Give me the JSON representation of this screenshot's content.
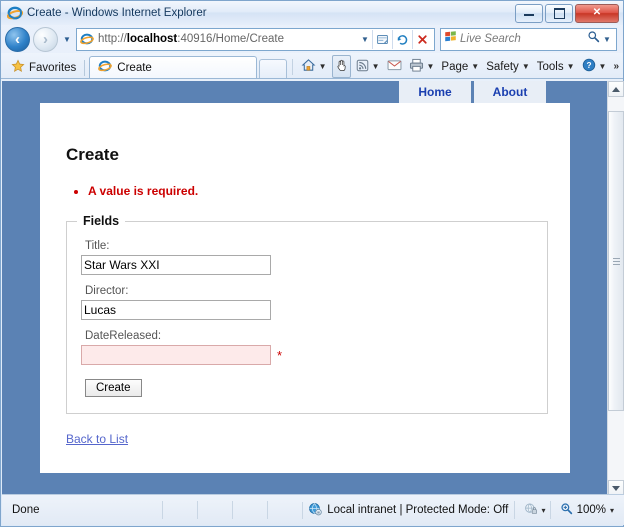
{
  "window": {
    "title": "Create - Windows Internet Explorer",
    "minimize_label": "Minimize",
    "maximize_label": "Maximize",
    "close_label": "Close"
  },
  "navigation": {
    "back_label": "Back",
    "forward_label": "Forward",
    "recent_pages_label": "Recent Pages",
    "url": "http://localhost:40916/Home/Create",
    "url_host": "localhost",
    "url_rest": ":40916/Home/Create",
    "url_scheme": "http://",
    "compat_view_label": "Compatibility View",
    "refresh_label": "Refresh",
    "stop_label": "Stop",
    "search_placeholder": "Live Search",
    "search_value": "",
    "search_go_label": "Search"
  },
  "tabbar": {
    "favorites_label": "Favorites",
    "tab_label": "Create",
    "new_tab_label": "New Tab"
  },
  "commandbar": {
    "home_label": "Home",
    "caret_browsing_label": "Caret Browsing",
    "feeds_label": "Feeds",
    "read_mail_label": "Read Mail",
    "print_label": "Print",
    "page_label": "Page",
    "safety_label": "Safety",
    "tools_label": "Tools",
    "help_label": "Help",
    "overflow_label": "»"
  },
  "site": {
    "nav": [
      {
        "label": "Home"
      },
      {
        "label": "About"
      }
    ],
    "accent_blue": "#5b82b4",
    "link_blue": "#1a3fb0"
  },
  "main": {
    "heading": "Create",
    "validation_errors": [
      "A value is required."
    ],
    "error_color": "#cc0000",
    "fieldset_legend": "Fields",
    "fields": [
      {
        "label": "Title:",
        "value": "Star Wars XXI",
        "placeholder": "",
        "invalid": false,
        "required_marker": ""
      },
      {
        "label": "Director:",
        "value": "Lucas",
        "placeholder": "",
        "invalid": false,
        "required_marker": ""
      },
      {
        "label": "DateReleased:",
        "value": "",
        "placeholder": "",
        "invalid": true,
        "required_marker": "*"
      }
    ],
    "submit_label": "Create",
    "back_link_label": "Back to List"
  },
  "statusbar": {
    "status_text": "Done",
    "zone_text": "Local intranet | Protected Mode: Off",
    "zone_caret": "▾",
    "privacy_caret": "▾",
    "zoom_text": "100%",
    "zoom_caret": "▾"
  }
}
